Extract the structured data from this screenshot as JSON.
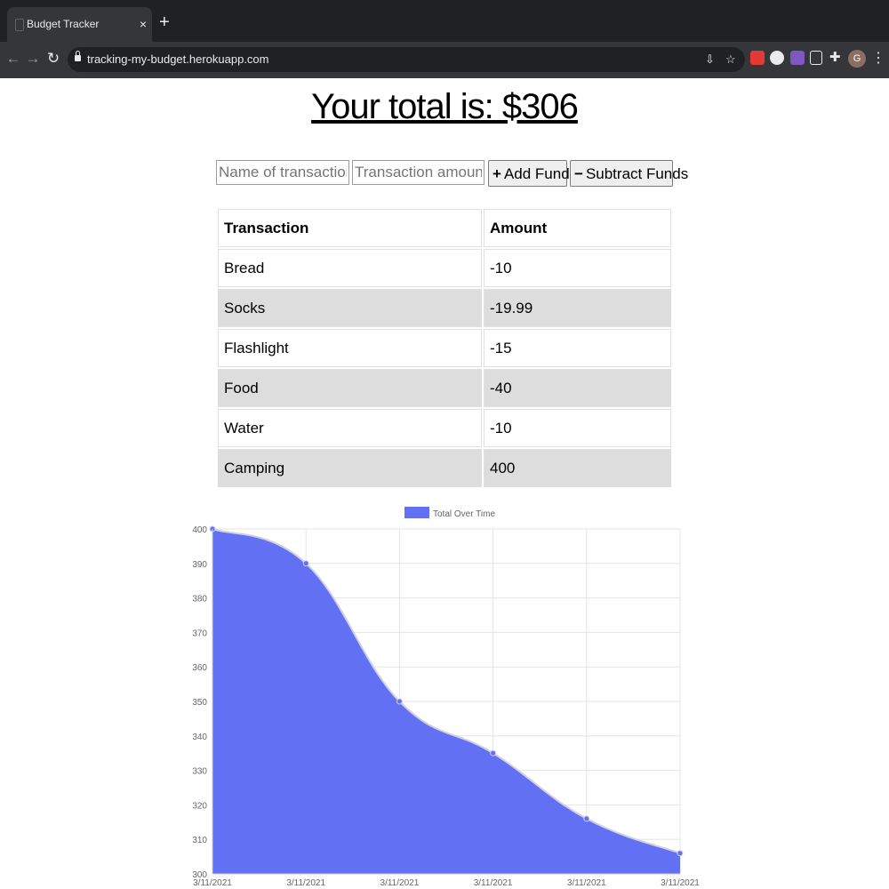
{
  "browser": {
    "tab_title": "Budget Tracker",
    "tab_close": "×",
    "new_tab": "+",
    "url": "tracking-my-budget.herokuapp.com",
    "avatar_letter": "G",
    "menu": "⋮",
    "extension_colors": [
      "#e53935",
      "#e8eaed",
      "#7e57c2",
      "#e8eaed",
      "#e8eaed"
    ]
  },
  "header": {
    "total": "Your total is: $306"
  },
  "form": {
    "name_placeholder": "Name of transaction",
    "amount_placeholder": "Transaction amount",
    "add_icon": "+",
    "add_label": "Add Funds",
    "sub_icon": "−",
    "sub_label": "Subtract Funds"
  },
  "table": {
    "headers": [
      "Transaction",
      "Amount"
    ],
    "rows": [
      [
        "Bread",
        "-10"
      ],
      [
        "Socks",
        "-19.99"
      ],
      [
        "Flashlight",
        "-15"
      ],
      [
        "Food",
        "-40"
      ],
      [
        "Water",
        "-10"
      ],
      [
        "Camping",
        "400"
      ]
    ]
  },
  "chart_data": {
    "type": "area",
    "title": "",
    "xlabel": "",
    "ylabel": "",
    "x": [
      "3/11/2021",
      "3/11/2021",
      "3/11/2021",
      "3/11/2021",
      "3/11/2021",
      "3/11/2021"
    ],
    "series": [
      {
        "name": "Total Over Time",
        "values": [
          400,
          390,
          350,
          335,
          316,
          306
        ],
        "color": "#6270f4"
      }
    ],
    "ylim": [
      300,
      400
    ],
    "yticks": [
      400,
      390,
      380,
      370,
      360,
      350,
      340,
      330,
      320,
      310,
      300
    ],
    "grid": true,
    "legend": "top"
  }
}
